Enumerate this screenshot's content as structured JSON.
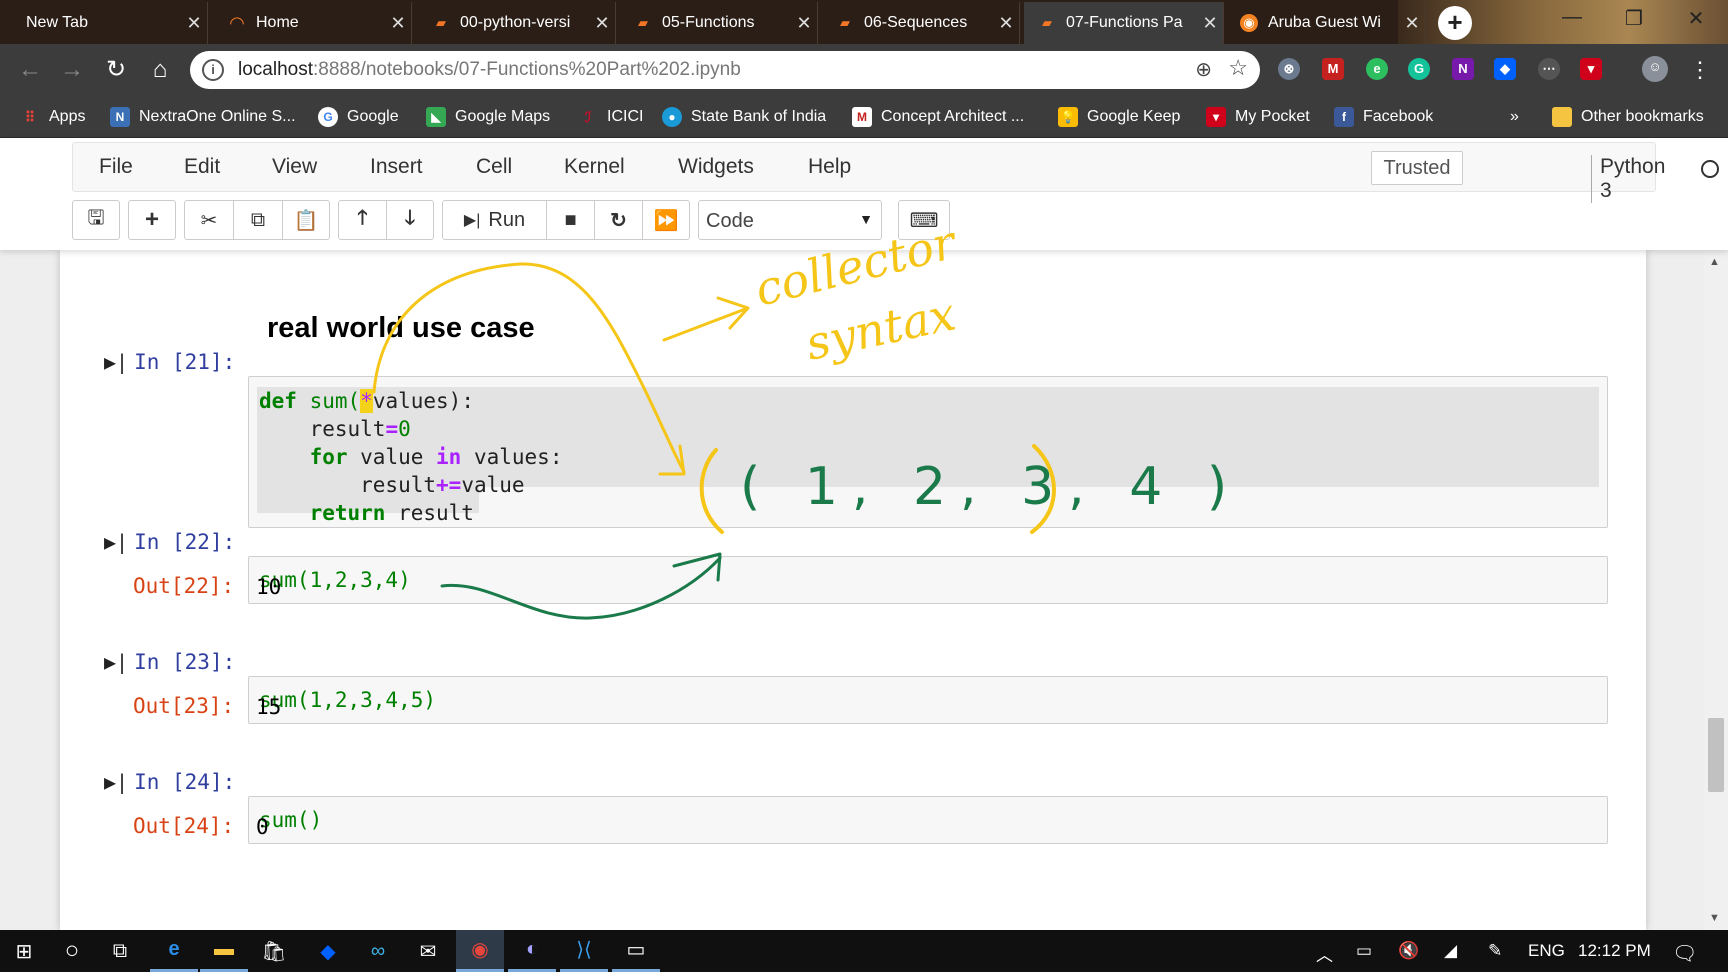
{
  "browser": {
    "tabs": [
      {
        "title": "New Tab",
        "icon": "blank-icon"
      },
      {
        "title": "Home",
        "icon": "jupyter-icon"
      },
      {
        "title": "00-python-versi",
        "icon": "notebook-icon"
      },
      {
        "title": "05-Functions",
        "icon": "notebook-icon"
      },
      {
        "title": "06-Sequences",
        "icon": "notebook-icon"
      },
      {
        "title": "07-Functions Pa",
        "icon": "notebook-icon",
        "active": true
      },
      {
        "title": "Aruba Guest Wi",
        "icon": "aruba-icon"
      }
    ],
    "url_host": "localhost",
    "url_path": ":8888/notebooks/07-Functions%20Part%202.ipynb",
    "bookmarks": [
      {
        "label": "Apps"
      },
      {
        "label": "NextraOne Online S..."
      },
      {
        "label": "Google"
      },
      {
        "label": "Google Maps"
      },
      {
        "label": "ICICI"
      },
      {
        "label": "State Bank of India"
      },
      {
        "label": "Concept Architect ..."
      },
      {
        "label": "Google Keep"
      },
      {
        "label": "My Pocket"
      },
      {
        "label": "Facebook"
      }
    ],
    "bookmarks_more": "»",
    "other_bookmarks": "Other bookmarks"
  },
  "jupyter": {
    "menu": [
      "File",
      "Edit",
      "View",
      "Insert",
      "Cell",
      "Kernel",
      "Widgets",
      "Help"
    ],
    "trusted": "Trusted",
    "kernel": "Python 3",
    "toolbar": {
      "run_label": "Run",
      "cell_type": "Code"
    }
  },
  "notebook": {
    "heading": "real world use case",
    "cells": [
      {
        "in": "In [21]:"
      },
      {
        "in": "In [22]:",
        "out": "Out[22]:",
        "out_value": "10"
      },
      {
        "in": "In [23]:",
        "out": "Out[23]:",
        "out_value": "15"
      },
      {
        "in": "In [24]:",
        "out": "Out[24]:",
        "out_value": "0"
      }
    ],
    "code21": {
      "l1_kw": "def",
      "l1_fn": " sum(",
      "l1_star": "*",
      "l1_rest": "values):",
      "l2_a": "    result",
      "l2_op": "=",
      "l2_num": "0",
      "l3_kw1": "    for",
      "l3_mid": " value ",
      "l3_kw2": "in",
      "l3_rest": " values:",
      "l4_a": "        result",
      "l4_op": "+=",
      "l4_b": "value",
      "l5_kw": "    return",
      "l5_rest": " result"
    },
    "code22": "sum(1,2,3,4)",
    "code23": "sum(1,2,3,4,5)",
    "code24": "sum()"
  },
  "annotations": {
    "note_collector": "collector",
    "note_syntax": "syntax",
    "tuple": "( 1, 2, 3, 4 )",
    "yellow": "#f5c518",
    "green": "#1a7a4a"
  },
  "taskbar": {
    "lang": "ENG",
    "time": "12:12 PM"
  }
}
